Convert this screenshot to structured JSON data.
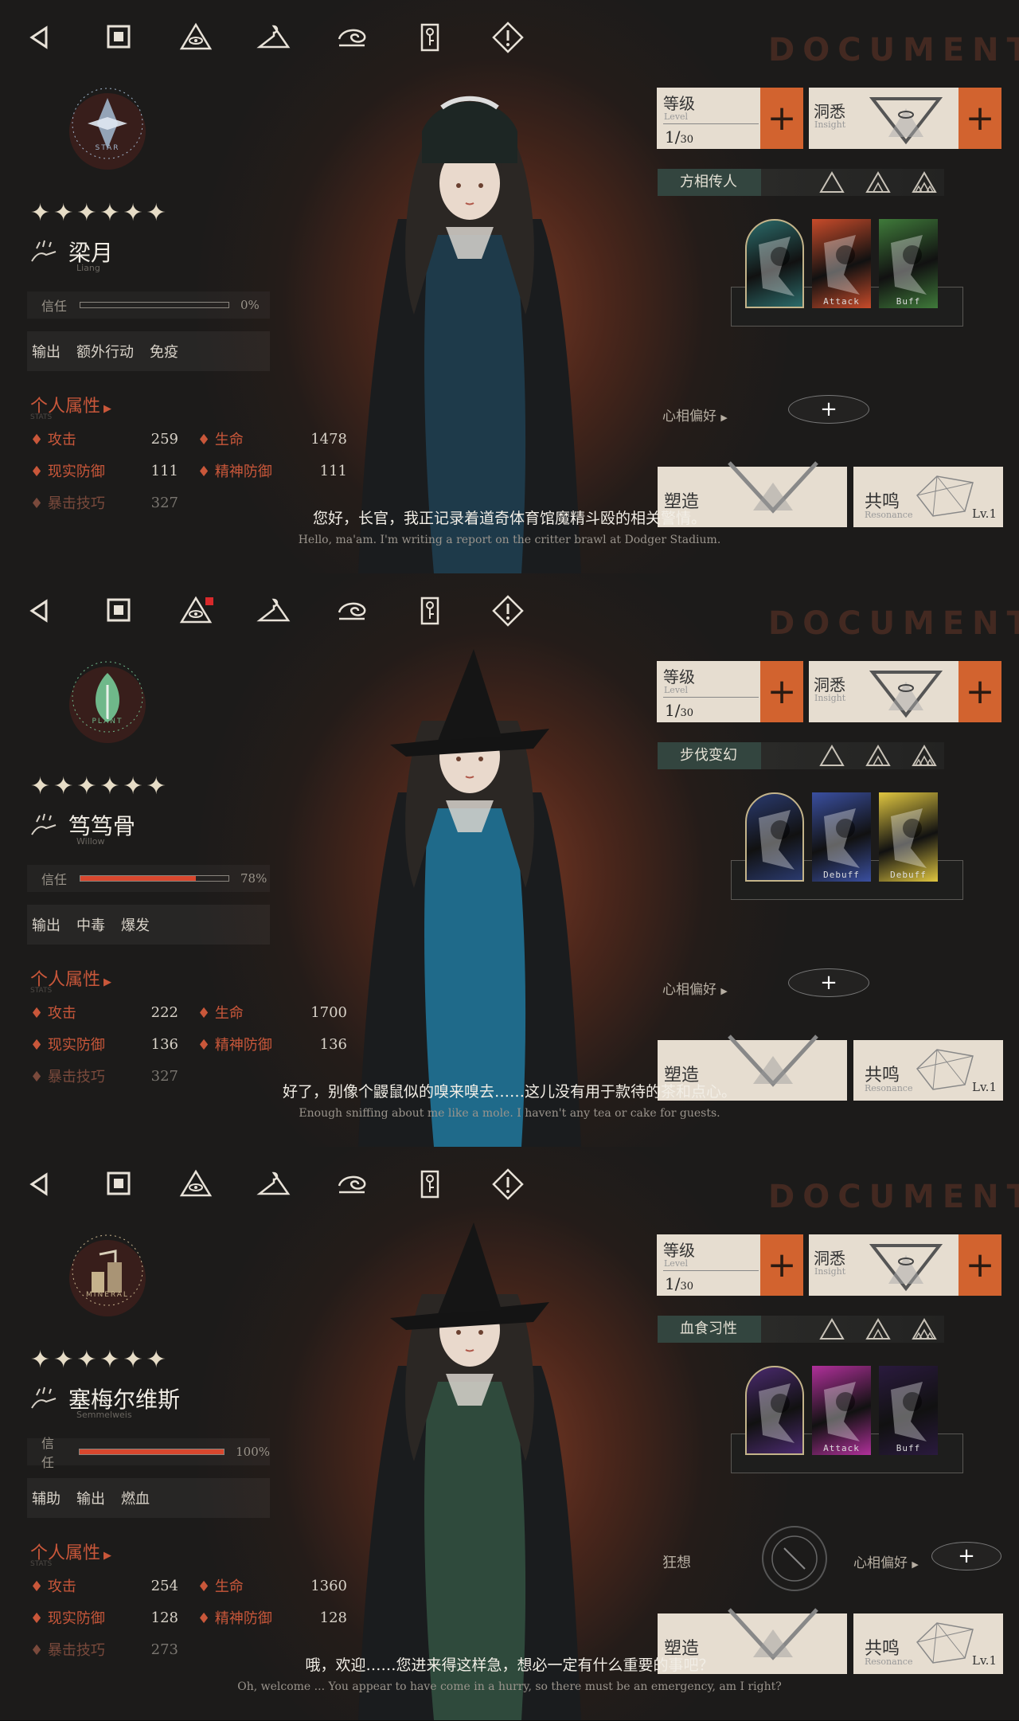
{
  "toolbar": [
    "back-icon",
    "stop-icon",
    "eye-pyramid-icon",
    "hanger-icon",
    "swirl-icon",
    "key-note-icon",
    "warning-icon"
  ],
  "bg_word": "DOCUMENT",
  "panels": [
    {
      "emblem_label": "STAR",
      "emblem_color": "#9fb3c9",
      "stars": "✦✦✦✦✦✦",
      "name": "梁月",
      "name_en": "Liang",
      "trust_label": "信任",
      "trust_value": 0,
      "trust_text": "0%",
      "tags": [
        "输出",
        "额外行动",
        "免疫"
      ],
      "attr_title": "个人属性",
      "attr_sub": "STATS",
      "stats": {
        "atk_l": "攻击",
        "atk": "259",
        "hp_l": "生命",
        "hp": "1478",
        "rdef_l": "现实防御",
        "rdef": "111",
        "mdef_l": "精神防御",
        "mdef": "111",
        "crit_l": "暴击技巧",
        "crit": "327"
      },
      "level": {
        "label": "等级",
        "label_en": "Level",
        "cur": "1",
        "max": "30"
      },
      "insight": {
        "label": "洞悉",
        "label_en": "Insight"
      },
      "path": "方相传人",
      "cards": [
        {
          "label": "",
          "color": "#2b6b6a"
        },
        {
          "label": "Attack",
          "color": "#c84b2a"
        },
        {
          "label": "Buff",
          "color": "#3f7a3a"
        }
      ],
      "pref_label": "心相偏好",
      "show_craze": false,
      "craze_label": "",
      "mold": "塑造",
      "resonance": {
        "label": "共鸣",
        "label_en": "Resonance",
        "lv": "Lv.1"
      },
      "subtitle_cn": "您好，长官，我正记录着道奇体育馆魔精斗殴的相关警情。",
      "subtitle_en": "Hello, ma'am. I'm writing a report on the critter brawl at Dodger Stadium.",
      "accent": "#1e3a4a"
    },
    {
      "emblem_label": "PLANT",
      "emblem_color": "#6fb88a",
      "stars": "✦✦✦✦✦✦",
      "name": "笃笃骨",
      "name_en": "Willow",
      "trust_label": "信任",
      "trust_value": 78,
      "trust_text": "78%",
      "tags": [
        "输出",
        "中毒",
        "爆发"
      ],
      "attr_title": "个人属性",
      "attr_sub": "STATS",
      "stats": {
        "atk_l": "攻击",
        "atk": "222",
        "hp_l": "生命",
        "hp": "1700",
        "rdef_l": "现实防御",
        "rdef": "136",
        "mdef_l": "精神防御",
        "mdef": "136",
        "crit_l": "暴击技巧",
        "crit": "327"
      },
      "level": {
        "label": "等级",
        "label_en": "Level",
        "cur": "1",
        "max": "30"
      },
      "insight": {
        "label": "洞悉",
        "label_en": "Insight"
      },
      "path": "步伐变幻",
      "cards": [
        {
          "label": "",
          "color": "#2a3a6e"
        },
        {
          "label": "Debuff",
          "color": "#3a4fa0"
        },
        {
          "label": "Debuff",
          "color": "#e0c640"
        }
      ],
      "pref_label": "心相偏好",
      "show_craze": false,
      "craze_label": "",
      "mold": "塑造",
      "resonance": {
        "label": "共鸣",
        "label_en": "Resonance",
        "lv": "Lv.1"
      },
      "subtitle_cn": "好了，别像个鼹鼠似的嗅来嗅去……这儿没有用于款待的茶和点心。",
      "subtitle_en": "Enough sniffing about me like a mole. I haven't any tea or cake for guests.",
      "accent": "#1f6a8a"
    },
    {
      "emblem_label": "MINERAL",
      "emblem_color": "#c6b28c",
      "stars": "✦✦✦✦✦✦",
      "name": "塞梅尔维斯",
      "name_en": "Semmelweis",
      "trust_label": "信任",
      "trust_value": 100,
      "trust_text": "100%",
      "tags": [
        "辅助",
        "输出",
        "燃血"
      ],
      "attr_title": "个人属性",
      "attr_sub": "STATS",
      "stats": {
        "atk_l": "攻击",
        "atk": "254",
        "hp_l": "生命",
        "hp": "1360",
        "rdef_l": "现实防御",
        "rdef": "128",
        "mdef_l": "精神防御",
        "mdef": "128",
        "crit_l": "暴击技巧",
        "crit": "273"
      },
      "level": {
        "label": "等级",
        "label_en": "Level",
        "cur": "1",
        "max": "30"
      },
      "insight": {
        "label": "洞悉",
        "label_en": "Insight"
      },
      "path": "血食习性",
      "cards": [
        {
          "label": "",
          "color": "#4a2a6e"
        },
        {
          "label": "Attack",
          "color": "#b0309a"
        },
        {
          "label": "Buff",
          "color": "#2a1a3e"
        }
      ],
      "pref_label": "心相偏好",
      "show_craze": true,
      "craze_label": "狂想",
      "mold": "塑造",
      "resonance": {
        "label": "共鸣",
        "label_en": "Resonance",
        "lv": "Lv.1"
      },
      "subtitle_cn": "哦，欢迎……您进来得这样急，想必一定有什么重要的事吧？",
      "subtitle_en": "Oh, welcome ... You appear to have come in a hurry, so there must be an emergency, am I right?",
      "accent": "#2f4a3c"
    }
  ]
}
